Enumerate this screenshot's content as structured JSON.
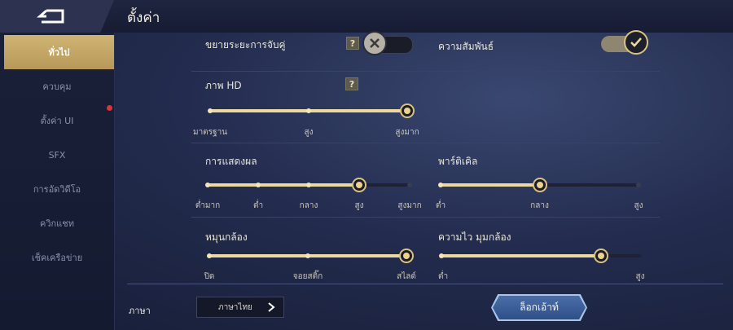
{
  "header": {
    "title": "ตั้งค่า",
    "back_icon": "back-arrow-icon"
  },
  "sidebar": {
    "items": [
      {
        "label": "ทั่วไป",
        "active": true
      },
      {
        "label": "ควบคุม",
        "active": false
      },
      {
        "label": "ตั้งค่า UI",
        "active": false,
        "badge": "red-dot"
      },
      {
        "label": "SFX",
        "active": false
      },
      {
        "label": "การอัดวิดีโอ",
        "active": false
      },
      {
        "label": "ควิกแชท",
        "active": false
      },
      {
        "label": "เช็คเครือข่าย",
        "active": false
      }
    ]
  },
  "settings": {
    "match_range": {
      "label": "ขยายระยะการจับคู่",
      "help": "?",
      "enabled": false
    },
    "relationship": {
      "label": "ความสัมพันธ์",
      "enabled": true
    },
    "hd": {
      "label": "ภาพ HD",
      "help": "?",
      "ticks": [
        "มาตรฐาน",
        "สูง",
        "สูงมาก"
      ],
      "selected_index": 2
    },
    "display": {
      "label": "การแสดงผล",
      "ticks": [
        "ต่ำมาก",
        "ต่ำ",
        "กลาง",
        "สูง",
        "สูงมาก"
      ],
      "selected_index": 3
    },
    "particle": {
      "label": "พาร์ติเคิล",
      "ticks": [
        "ต่ำ",
        "กลาง",
        "สูง"
      ],
      "selected_index": 1
    },
    "camera_rotate": {
      "label": "หมุนกล้อง",
      "ticks": [
        "ปิด",
        "จอยสติ๊ก",
        "สไลด์"
      ],
      "selected_index": 2
    },
    "camera_speed": {
      "label": "ความไว มุมกล้อง",
      "min_label": "ต่ำ",
      "max_label": "สูง",
      "value_fraction": 0.8
    }
  },
  "footer": {
    "language_label": "ภาษา",
    "language_value": "ภาษาไทย",
    "logout_label": "ล็อกเอ้าท์"
  },
  "colors": {
    "accent": "#ecd9a0",
    "active_tab": "#c6a967",
    "badge": "#e0323a",
    "logout": "#3b5d97"
  }
}
